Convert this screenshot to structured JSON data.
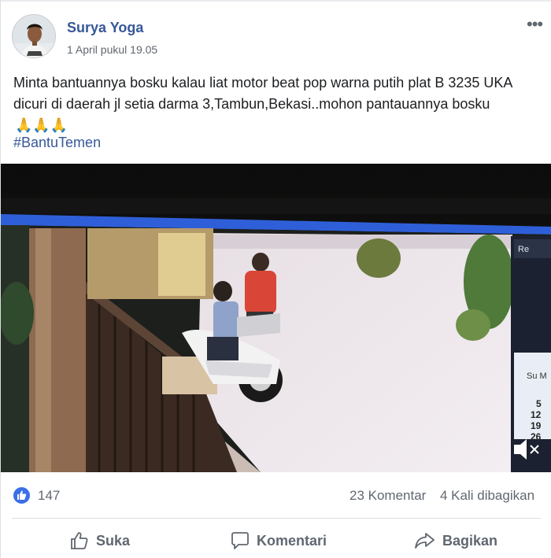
{
  "post": {
    "author": "Surya Yoga",
    "timestamp": "1 April pukul 19.05",
    "text": "Minta bantuannya bosku kalau liat motor beat pop warna putih plat B 3235 UKA dicuri di daerah jl setia darma 3,Tambun,Bekasi..mohon pantauannya bosku",
    "emoji": "🙏🙏🙏",
    "hashtag": "#BantuTemen",
    "more_icon": "more-horizontal-icon",
    "more_glyph": "•••"
  },
  "video": {
    "overlay_text": {
      "rec": "Re",
      "su": "Su M",
      "days": [
        "5",
        "12",
        "19",
        "26"
      ]
    },
    "volume_icon": "volume-muted-icon"
  },
  "reactions": {
    "like_count": "147",
    "comments": "23 Komentar",
    "shares": "4 Kali dibagikan",
    "like_color": "#3b6ee8"
  },
  "actions": {
    "like": "Suka",
    "comment": "Komentari",
    "share": "Bagikan"
  },
  "colors": {
    "author_link": "#365899",
    "meta_text": "#606770"
  }
}
